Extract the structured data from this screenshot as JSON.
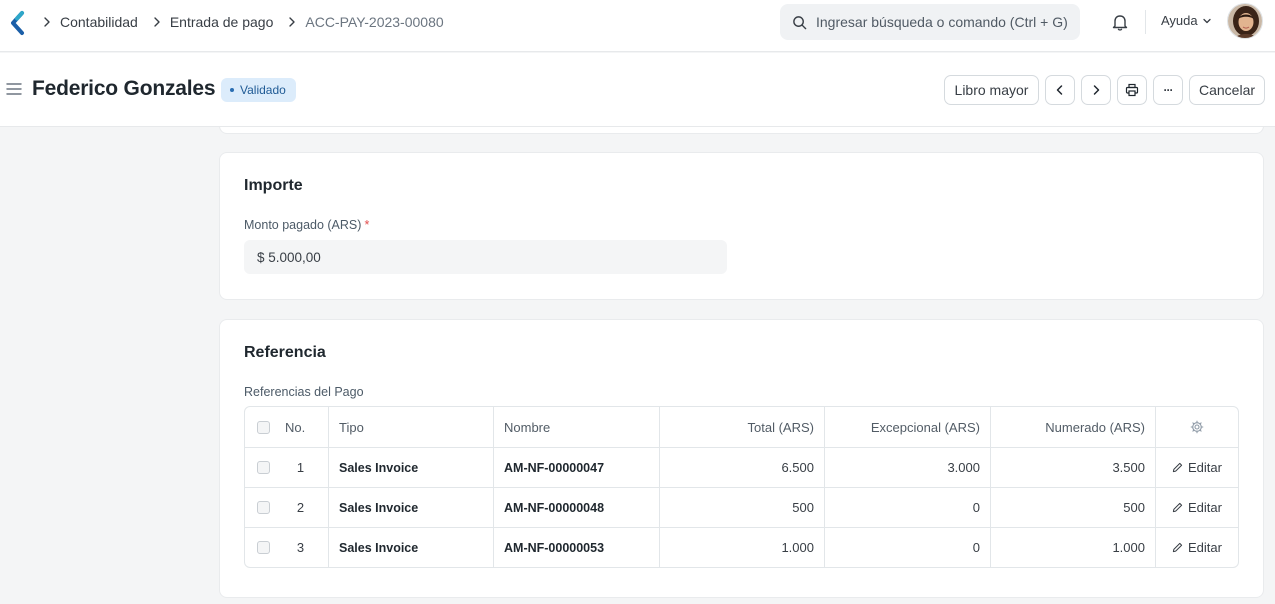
{
  "breadcrumb": {
    "items": [
      "Contabilidad",
      "Entrada de pago",
      "ACC-PAY-2023-00080"
    ]
  },
  "search": {
    "placeholder": "Ingresar búsqueda o comando (Ctrl + G)"
  },
  "help": {
    "label": "Ayuda"
  },
  "header": {
    "title": "Federico Gonzales",
    "status": "Validado",
    "buttons": {
      "ledger": "Libro mayor",
      "cancel": "Cancelar",
      "more": "···"
    }
  },
  "importe": {
    "section_title": "Importe",
    "field_label": "Monto pagado (ARS)",
    "required_mark": "*",
    "field_value": "$ 5.000,00"
  },
  "referencia": {
    "section_title": "Referencia",
    "table_label": "Referencias del Pago",
    "columns": {
      "no": "No.",
      "tipo": "Tipo",
      "nombre": "Nombre",
      "total": "Total (ARS)",
      "excepcional": "Excepcional (ARS)",
      "numerado": "Numerado (ARS)"
    },
    "edit_label": "Editar",
    "rows": [
      {
        "no": "1",
        "tipo": "Sales Invoice",
        "nombre": "AM-NF-00000047",
        "total": "6.500",
        "excepcional": "3.000",
        "numerado": "3.500"
      },
      {
        "no": "2",
        "tipo": "Sales Invoice",
        "nombre": "AM-NF-00000048",
        "total": "500",
        "excepcional": "0",
        "numerado": "500"
      },
      {
        "no": "3",
        "tipo": "Sales Invoice",
        "nombre": "AM-NF-00000053",
        "total": "1.000",
        "excepcional": "0",
        "numerado": "1.000"
      }
    ]
  },
  "colors": {
    "status_bg": "#dcecfb",
    "status_text": "#205b95",
    "logo_blue": "#1c5fa8",
    "logo_teal": "#2ea7c9"
  },
  "icons": [
    "app-logo-icon",
    "chevron-right-icon",
    "search-icon",
    "bell-icon",
    "chevron-down-icon",
    "menu-icon",
    "chevron-left-icon",
    "printer-icon",
    "ellipsis-icon",
    "gear-icon",
    "pencil-icon"
  ]
}
